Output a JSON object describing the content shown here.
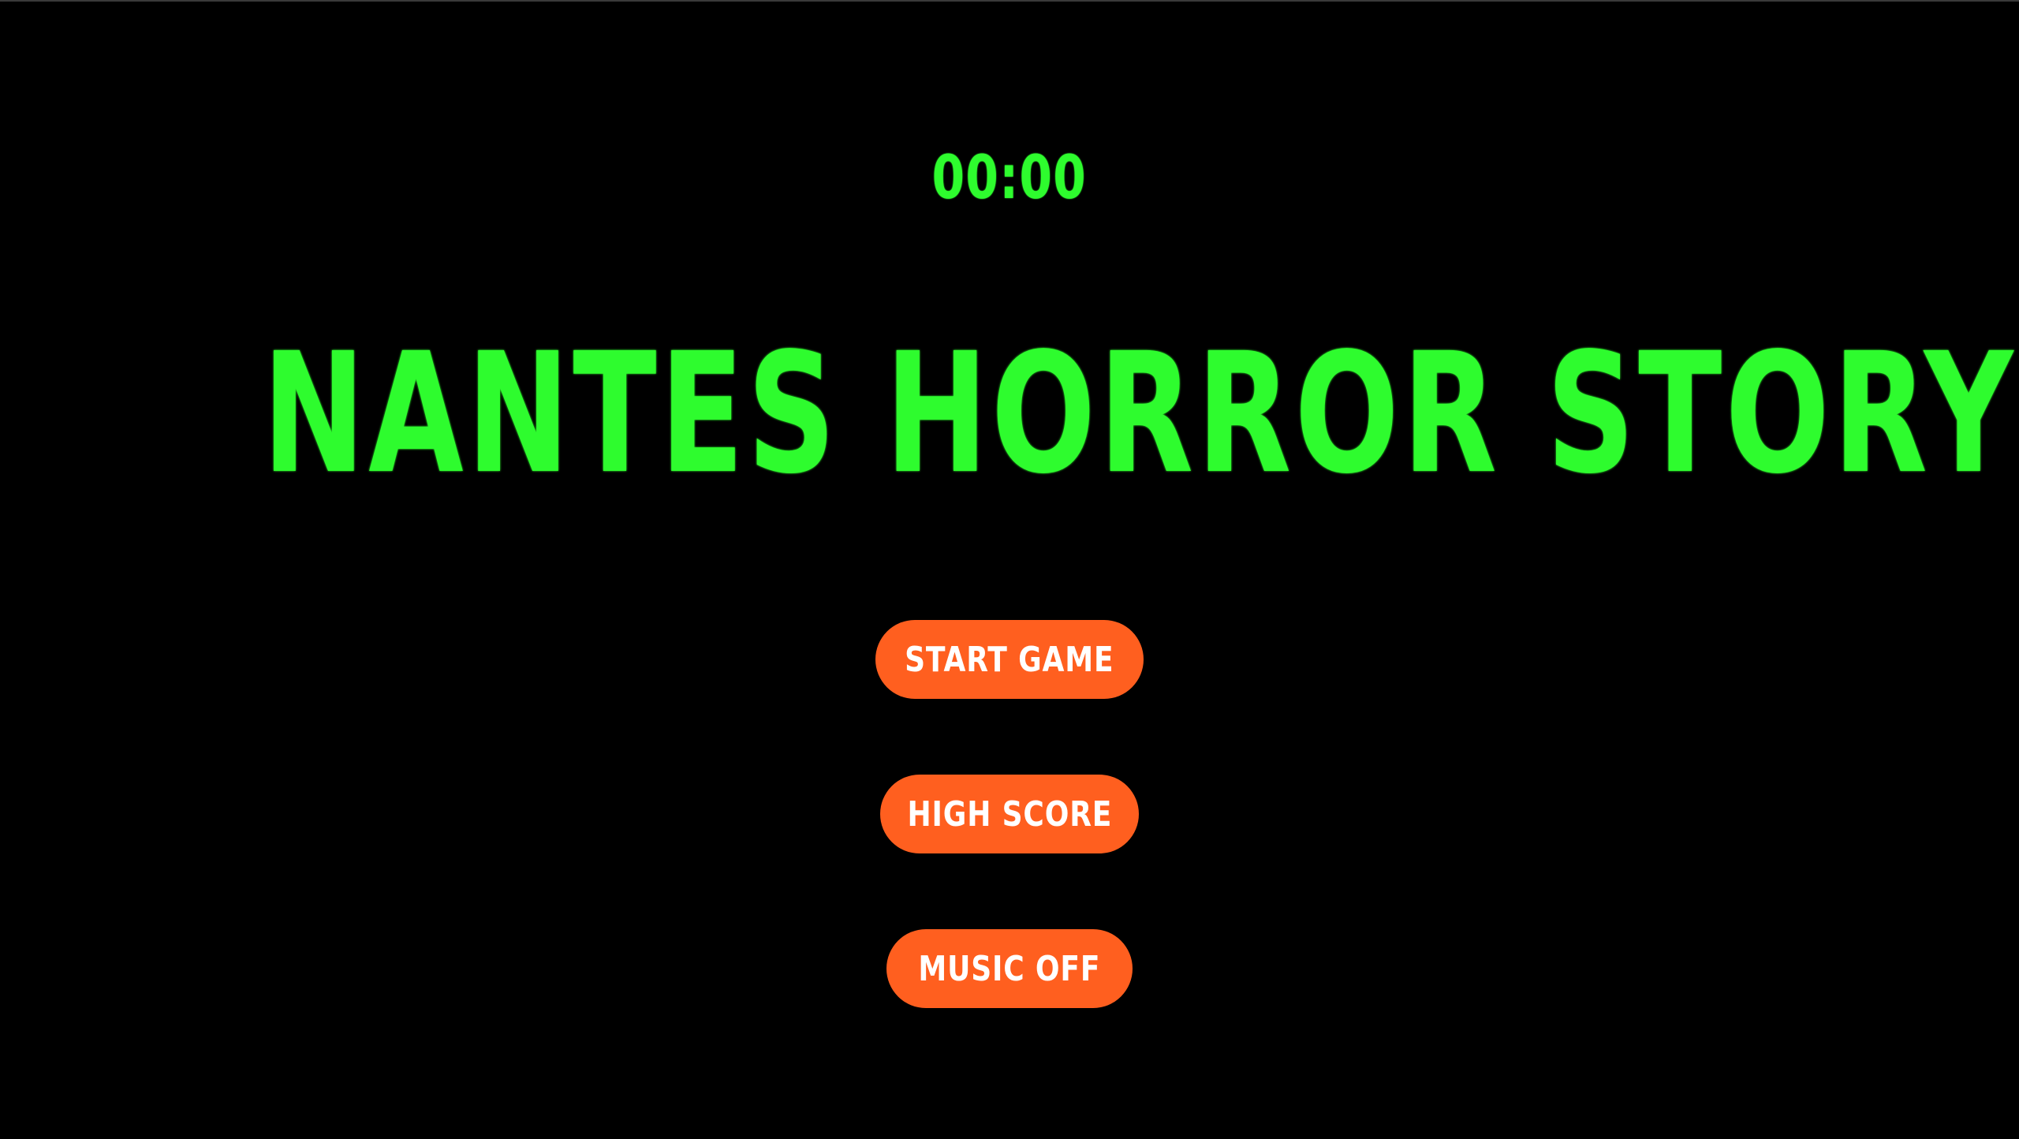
{
  "game": {
    "timer": "00:00",
    "title": "NANTES HORROR STORY"
  },
  "menu": {
    "start_label": "START GAME",
    "highscore_label": "HIGH SCORE",
    "music_label": "MUSIC OFF"
  },
  "colors": {
    "background": "#000000",
    "title_green": "#2efc2e",
    "button_orange": "#ff5f1f",
    "button_text": "#ffffff"
  }
}
